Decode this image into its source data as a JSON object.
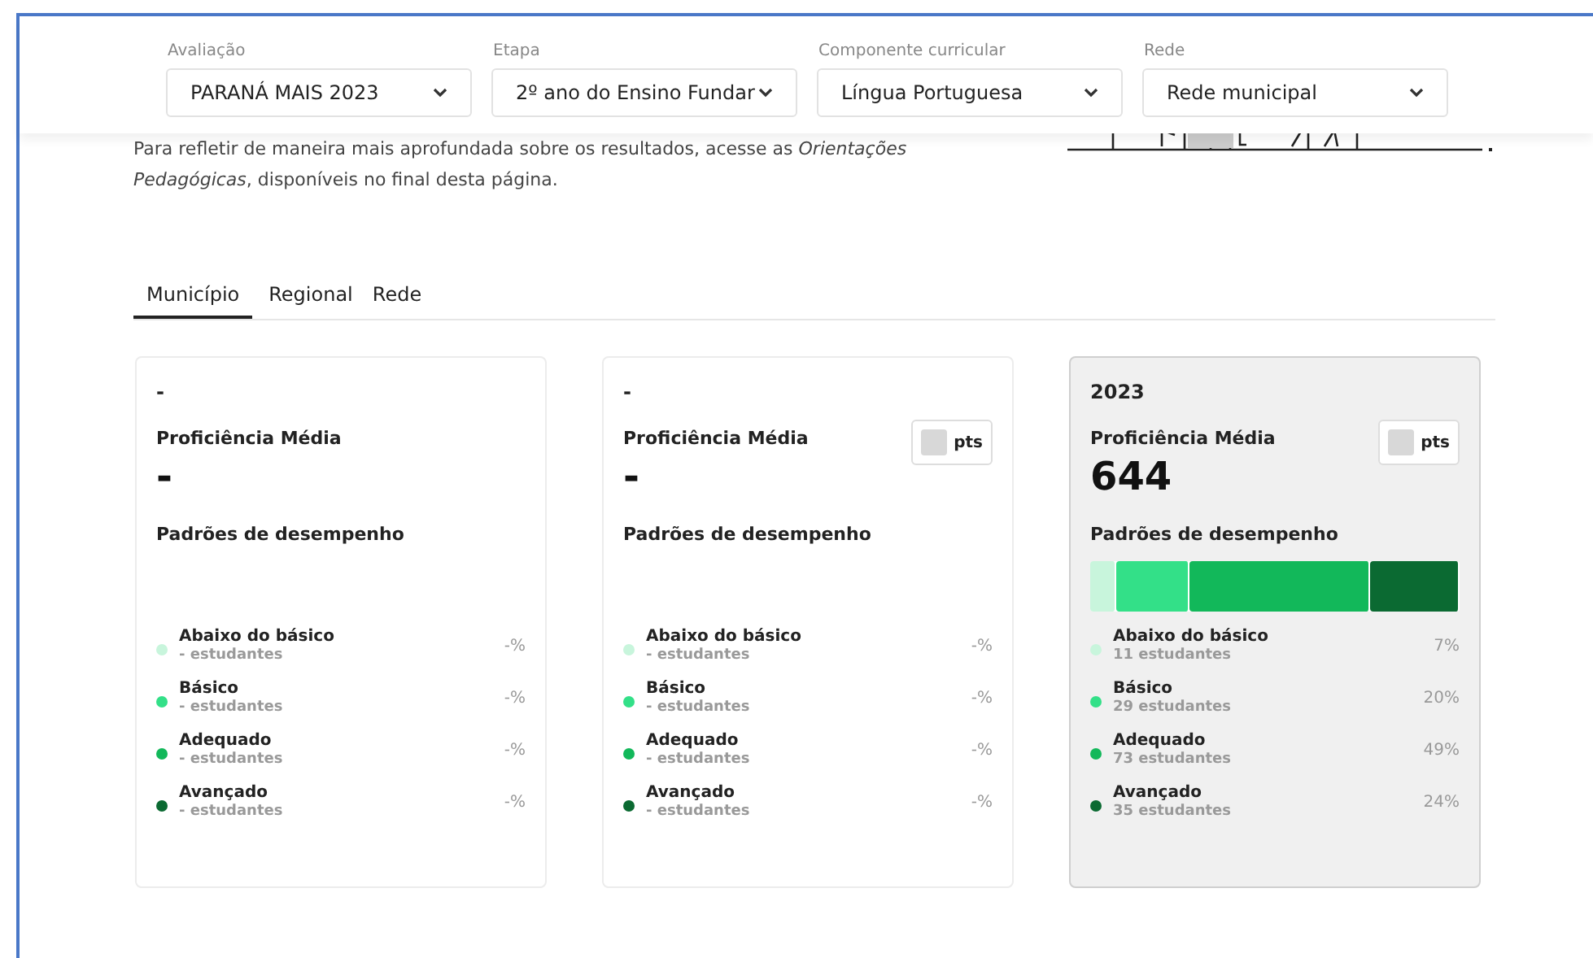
{
  "filters": [
    {
      "label": "Avaliação",
      "value": "PARANÁ MAIS 2023"
    },
    {
      "label": "Etapa",
      "value": "2º ano do Ensino Fundar"
    },
    {
      "label": "Componente curricular",
      "value": "Língua Portuguesa"
    },
    {
      "label": "Rede",
      "value": "Rede municipal"
    }
  ],
  "intro": "Para refletir de maneira mais aprofundada sobre os resultados, acesse as *Orientações Pedagógicas*, disponíveis no final desta página.",
  "tabs": [
    {
      "label": "Município",
      "selected": true
    },
    {
      "label": "Regional",
      "selected": false
    },
    {
      "label": "Rede",
      "selected": false
    }
  ],
  "cards": [
    {
      "year": "-",
      "proficiency_label": "Proficiência Média",
      "proficiency": "-",
      "selected": false,
      "standards_title": "Padrões de desempenho",
      "levels": [
        {
          "name": "Abaixo do básico",
          "students": "- estudantes",
          "percent": "-%",
          "color": "#c8f5dc"
        },
        {
          "name": "Básico",
          "students": "- estudantes",
          "percent": "-%",
          "color": "#33e088"
        },
        {
          "name": "Adequado",
          "students": "- estudantes",
          "percent": "-%",
          "color": "#12b85a"
        },
        {
          "name": "Avançado",
          "students": "- estudantes",
          "percent": "-%",
          "color": "#0b6a32"
        }
      ]
    },
    {
      "year": "-",
      "proficiency_label": "Proficiência Média",
      "proficiency": "-",
      "unit": "pts",
      "selected": false,
      "standards_title": "Padrões de desempenho",
      "levels": [
        {
          "name": "Abaixo do básico",
          "students": "- estudantes",
          "percent": "-%",
          "color": "#c8f5dc"
        },
        {
          "name": "Básico",
          "students": "- estudantes",
          "percent": "-%",
          "color": "#33e088"
        },
        {
          "name": "Adequado",
          "students": "- estudantes",
          "percent": "-%",
          "color": "#12b85a"
        },
        {
          "name": "Avançado",
          "students": "- estudantes",
          "percent": "-%",
          "color": "#0b6a32"
        }
      ]
    },
    {
      "year": "2023",
      "proficiency_label": "Proficiência Média",
      "proficiency": "644",
      "unit": "pts",
      "selected": true,
      "standards_title": "Padrões de desempenho",
      "levels": [
        {
          "name": "Abaixo do básico",
          "students": "11 estudantes",
          "percent": "7%",
          "color": "#c8f5dc",
          "level": 0.07
        },
        {
          "name": "Básico",
          "students": "29 estudantes",
          "percent": "20%",
          "color": "#33e088",
          "level": 0.2
        },
        {
          "name": "Adequado",
          "students": "73 estudantes",
          "percent": "49%",
          "color": "#12b85a",
          "level": 0.49
        },
        {
          "name": "Avançado",
          "students": "35 estudantes",
          "percent": "24%",
          "color": "#0b6a32",
          "level": 0.24
        }
      ]
    }
  ]
}
